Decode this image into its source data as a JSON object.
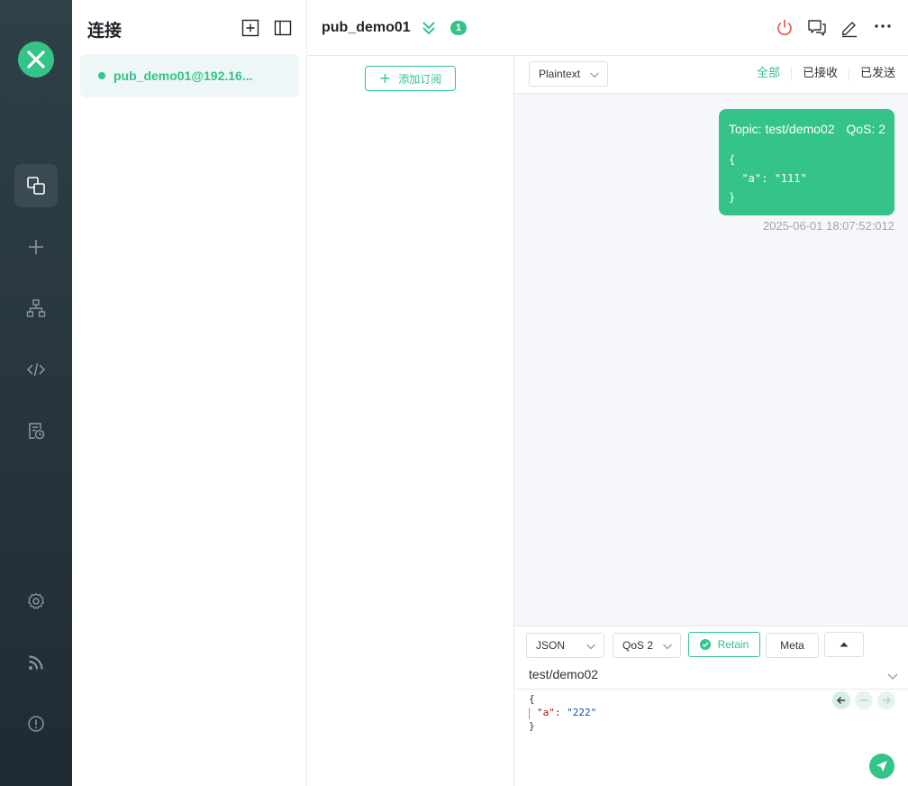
{
  "nav": {
    "items": [
      {
        "name": "connections",
        "icon": "connections-icon",
        "active": true
      },
      {
        "name": "new",
        "icon": "plus-icon"
      },
      {
        "name": "topic-tree",
        "icon": "sitemap-icon"
      },
      {
        "name": "scripts",
        "icon": "code-icon"
      },
      {
        "name": "logs",
        "icon": "log-icon"
      },
      {
        "name": "settings",
        "icon": "gear-icon"
      },
      {
        "name": "feed",
        "icon": "rss-icon"
      },
      {
        "name": "about",
        "icon": "info-icon"
      }
    ]
  },
  "connections": {
    "title": "连接",
    "items": [
      {
        "name": "pub_demo01@192.16...",
        "status": "connected"
      }
    ]
  },
  "header": {
    "title": "pub_demo01",
    "badge": "1"
  },
  "subscriptions": {
    "add_label": "添加订阅"
  },
  "messages": {
    "format": "Plaintext",
    "filters": [
      "全部",
      "已接收",
      "已发送"
    ],
    "active_filter": "全部",
    "items": [
      {
        "topic": "Topic: test/demo02",
        "qos": "QoS: 2",
        "payload": "{\n  \"a\": \"111\"\n}",
        "time": "2025-06-01 18:07:52:012",
        "direction": "sent"
      }
    ]
  },
  "publish": {
    "format": "JSON",
    "qos": "QoS 2",
    "retain_label": "Retain",
    "meta_label": "Meta",
    "topic": "test/demo02",
    "payload_open": "{",
    "payload_key": "\"a\"",
    "payload_colon": ": ",
    "payload_value": "\"222\"",
    "payload_close": "}"
  },
  "colors": {
    "accent": "#34c388",
    "nav_bg": "#2a3840",
    "danger": "#e5534b"
  }
}
